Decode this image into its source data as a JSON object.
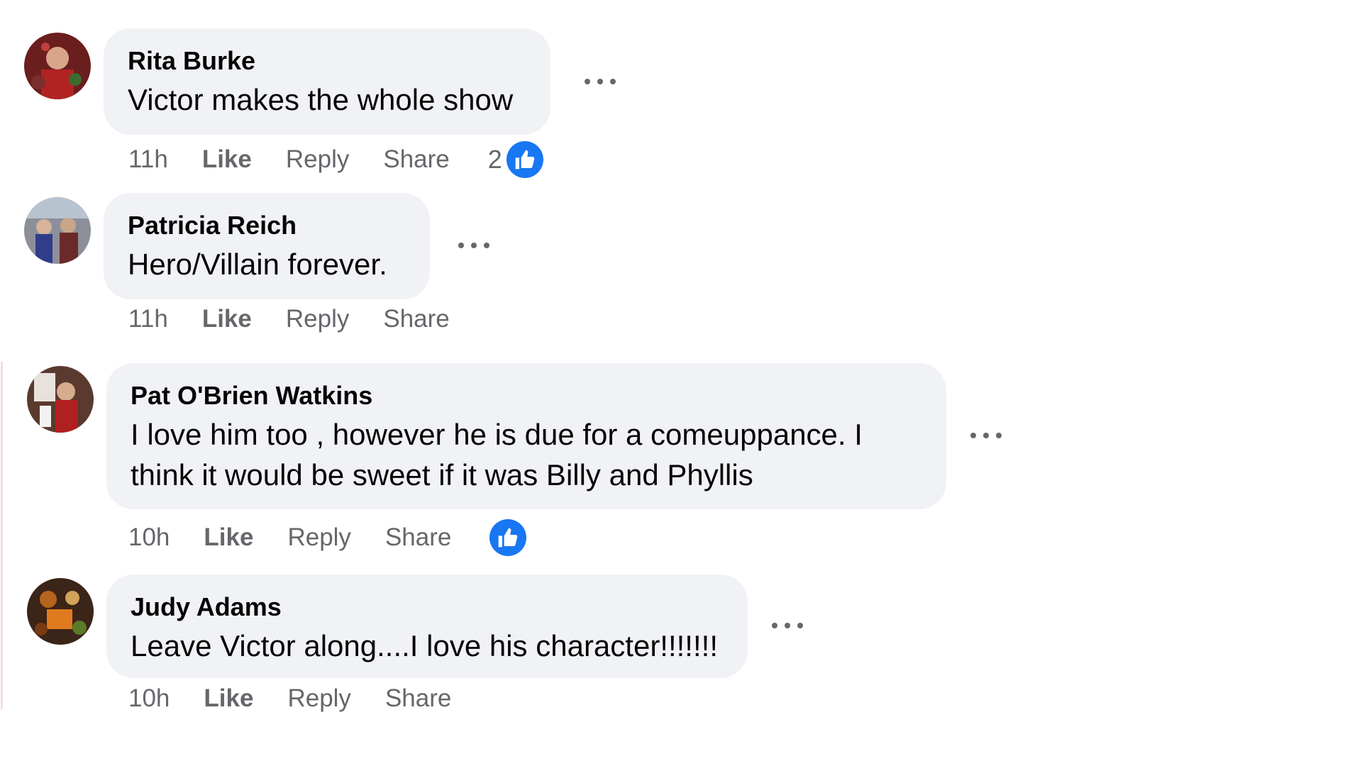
{
  "comments": [
    {
      "author": "Rita Burke",
      "text": "Victor makes the whole show",
      "time": "11h",
      "like_label": "Like",
      "reply_label": "Reply",
      "share_label": "Share",
      "reaction_count": "2",
      "reaction_icon": "like-icon"
    },
    {
      "author": "Patricia Reich",
      "text": "Hero/Villain forever.",
      "time": "11h",
      "like_label": "Like",
      "reply_label": "Reply",
      "share_label": "Share"
    },
    {
      "author": "Pat O'Brien Watkins",
      "text": "I love him too , however he is due for a comeuppance. I think it would be sweet if it was Billy and Phyllis",
      "time": "10h",
      "like_label": "Like",
      "reply_label": "Reply",
      "share_label": "Share",
      "reaction_icon": "like-icon"
    },
    {
      "author": "Judy Adams",
      "text": "Leave Victor along....I love his character!!!!!!!",
      "time": "10h",
      "like_label": "Like",
      "reply_label": "Reply",
      "share_label": "Share"
    }
  ],
  "colors": {
    "bubble": "#f0f2f5",
    "meta_text": "#65676b",
    "like_blue": "#1877f2"
  }
}
